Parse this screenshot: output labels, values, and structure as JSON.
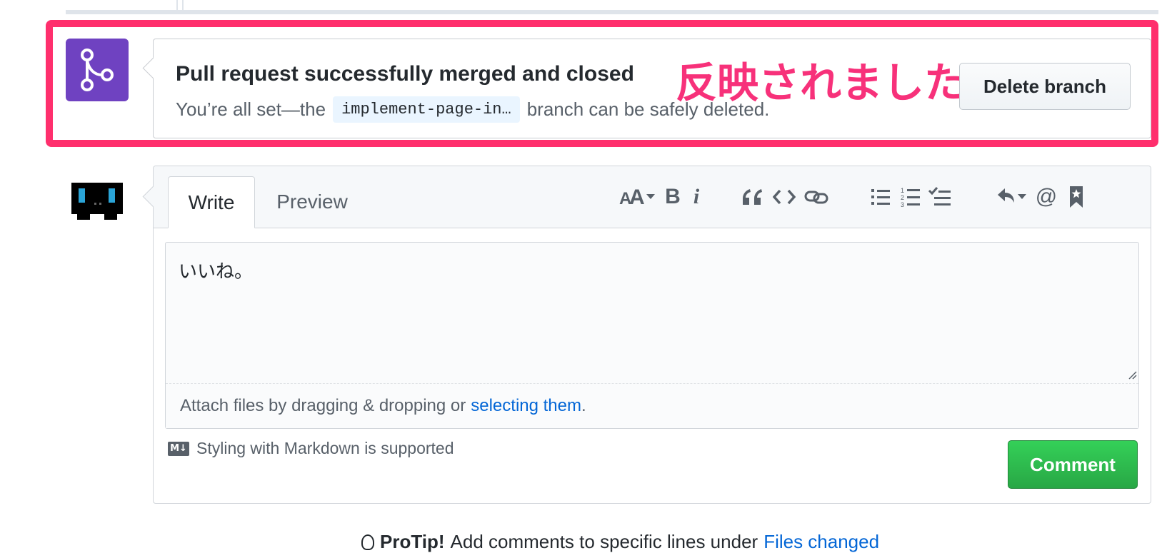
{
  "merge_status": {
    "title": "Pull request successfully merged and closed",
    "desc_before": "You’re all set—the",
    "branch_name": "implement-page-in…",
    "desc_after": "branch can be safely deleted.",
    "delete_button": "Delete branch",
    "annotation": "反映されました"
  },
  "comment_form": {
    "tabs": [
      {
        "label": "Write",
        "active": true
      },
      {
        "label": "Preview",
        "active": false
      }
    ],
    "toolbar": [
      {
        "icon": "text-size-icon"
      },
      {
        "icon": "bold-icon",
        "label": "B"
      },
      {
        "icon": "italic-icon",
        "label": "i"
      },
      {
        "icon": "quote-icon"
      },
      {
        "icon": "code-icon"
      },
      {
        "icon": "link-icon"
      },
      {
        "icon": "unordered-list-icon"
      },
      {
        "icon": "ordered-list-icon"
      },
      {
        "icon": "task-list-icon"
      },
      {
        "icon": "reply-icon"
      },
      {
        "icon": "mention-icon",
        "label": "@"
      },
      {
        "icon": "bookmark-icon"
      }
    ],
    "editor_value": "いいね。",
    "attach_text": "Attach files by dragging & dropping or",
    "attach_link": "selecting them",
    "attach_period": ".",
    "markdown_note": "Styling with Markdown is supported",
    "markdown_badge": "M↓",
    "comment_button": "Comment"
  },
  "protip": {
    "label": "ProTip!",
    "text": "Add comments to specific lines under",
    "link": "Files changed"
  },
  "colors": {
    "merged_purple": "#6f42c1",
    "annotation_pink": "#f7317a",
    "highlight_border": "#ff2f6d",
    "comment_green": "#28a745",
    "link_blue": "#0366d6"
  }
}
